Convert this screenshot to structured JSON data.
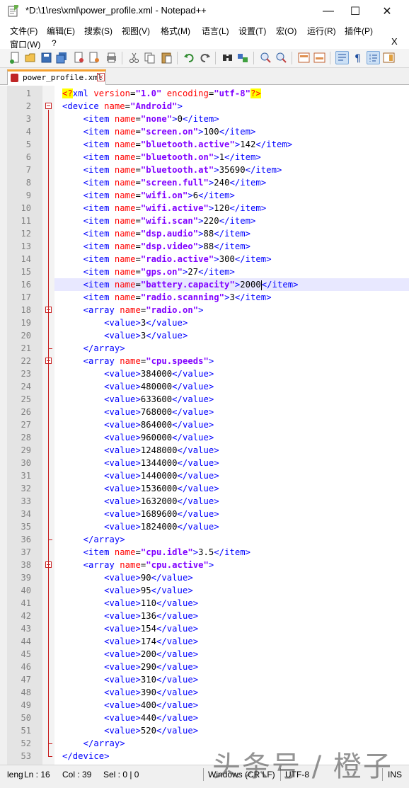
{
  "window": {
    "title": "*D:\\1\\res\\xml\\power_profile.xml - Notepad++",
    "minimize": "—",
    "maximize": "☐",
    "close": "✕"
  },
  "menu": {
    "items": [
      "文件(F)",
      "编辑(E)",
      "搜索(S)",
      "视图(V)",
      "格式(M)",
      "语言(L)",
      "设置(T)",
      "宏(O)",
      "运行(R)",
      "插件(P)"
    ],
    "items_row2": [
      "窗口(W)",
      "?"
    ],
    "close_doc": "X"
  },
  "tab": {
    "label": "power_profile.xml",
    "close": "✕"
  },
  "editor": {
    "current_line": 16,
    "line_numbers": [
      "1",
      "2",
      "3",
      "4",
      "5",
      "6",
      "7",
      "8",
      "9",
      "10",
      "11",
      "12",
      "13",
      "14",
      "15",
      "16",
      "17",
      "18",
      "19",
      "20",
      "21",
      "22",
      "23",
      "24",
      "25",
      "26",
      "27",
      "28",
      "29",
      "30",
      "31",
      "32",
      "33",
      "34",
      "35",
      "36",
      "37",
      "38",
      "39",
      "40",
      "41",
      "42",
      "43",
      "44",
      "45",
      "46",
      "47",
      "48",
      "49",
      "50",
      "51",
      "52",
      "53"
    ],
    "lines": [
      "<?xml version=\"1.0\" encoding=\"utf-8\"?>",
      "<device name=\"Android\">",
      "    <item name=\"none\">0</item>",
      "    <item name=\"screen.on\">100</item>",
      "    <item name=\"bluetooth.active\">142</item>",
      "    <item name=\"bluetooth.on\">1</item>",
      "    <item name=\"bluetooth.at\">35690</item>",
      "    <item name=\"screen.full\">240</item>",
      "    <item name=\"wifi.on\">6</item>",
      "    <item name=\"wifi.active\">120</item>",
      "    <item name=\"wifi.scan\">220</item>",
      "    <item name=\"dsp.audio\">88</item>",
      "    <item name=\"dsp.video\">88</item>",
      "    <item name=\"radio.active\">300</item>",
      "    <item name=\"gps.on\">27</item>",
      "    <item name=\"battery.capacity\">2000</item>",
      "    <item name=\"radio.scanning\">3</item>",
      "    <array name=\"radio.on\">",
      "        <value>3</value>",
      "        <value>3</value>",
      "    </array>",
      "    <array name=\"cpu.speeds\">",
      "        <value>384000</value>",
      "        <value>480000</value>",
      "        <value>633600</value>",
      "        <value>768000</value>",
      "        <value>864000</value>",
      "        <value>960000</value>",
      "        <value>1248000</value>",
      "        <value>1344000</value>",
      "        <value>1440000</value>",
      "        <value>1536000</value>",
      "        <value>1632000</value>",
      "        <value>1689600</value>",
      "        <value>1824000</value>",
      "    </array>",
      "    <item name=\"cpu.idle\">3.5</item>",
      "    <array name=\"cpu.active\">",
      "        <value>90</value>",
      "        <value>95</value>",
      "        <value>110</value>",
      "        <value>136</value>",
      "        <value>154</value>",
      "        <value>174</value>",
      "        <value>200</value>",
      "        <value>290</value>",
      "        <value>310</value>",
      "        <value>390</value>",
      "        <value>400</value>",
      "        <value>440</value>",
      "        <value>520</value>",
      "    </array>",
      "</device>"
    ]
  },
  "status": {
    "length": "leng",
    "ln": "Ln : 16",
    "col": "Col : 39",
    "sel": "Sel : 0 | 0",
    "eol": "Windows (CR LF)",
    "encoding": "UTF-8",
    "mode": "INS"
  },
  "watermark": "头条号 / 橙子"
}
